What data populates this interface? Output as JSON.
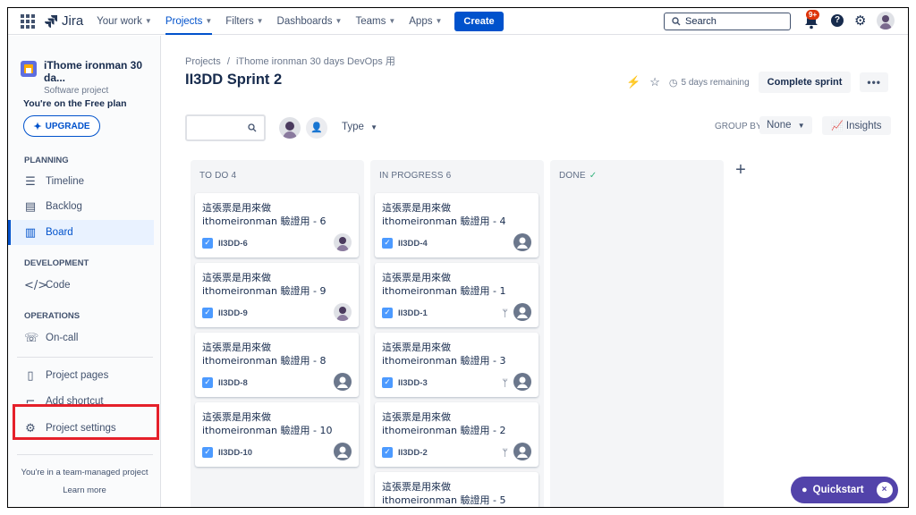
{
  "topnav": {
    "logo_text": "Jira",
    "items": [
      {
        "label": "Your work"
      },
      {
        "label": "Projects"
      },
      {
        "label": "Filters"
      },
      {
        "label": "Dashboards"
      },
      {
        "label": "Teams"
      },
      {
        "label": "Apps"
      }
    ],
    "create_label": "Create",
    "search_placeholder": "Search",
    "notification_badge": "9+"
  },
  "sidebar": {
    "project_name": "iThome ironman 30 da...",
    "project_type": "Software project",
    "plan_text": "You're on the Free plan",
    "upgrade_label": "UPGRADE",
    "planning_title": "PLANNING",
    "timeline_label": "Timeline",
    "backlog_label": "Backlog",
    "board_label": "Board",
    "development_title": "DEVELOPMENT",
    "code_label": "Code",
    "operations_title": "OPERATIONS",
    "oncall_label": "On-call",
    "pages_label": "Project pages",
    "shortcut_label": "Add shortcut",
    "settings_label": "Project settings",
    "team_managed_text": "You're in a team-managed project",
    "learn_more_label": "Learn more"
  },
  "main": {
    "breadcrumb_projects": "Projects",
    "breadcrumb_sep": "/",
    "breadcrumb_project": "iThome ironman 30 days DevOps 用",
    "title": "II3DD Sprint 2",
    "remaining": "5 days remaining",
    "complete_label": "Complete sprint",
    "more_label": "•••",
    "type_label": "Type",
    "group_by_label": "GROUP BY",
    "group_by_value": "None",
    "insights_label": "Insights"
  },
  "columns": [
    {
      "title": "TO DO 4",
      "cards": [
        {
          "title": "這張票是用來做 ithomeironman 驗證用 - 6",
          "key": "II3DD-6",
          "avatar": "photo",
          "branch": false
        },
        {
          "title": "這張票是用來做 ithomeironman 驗證用 - 9",
          "key": "II3DD-9",
          "avatar": "photo",
          "branch": false
        },
        {
          "title": "這張票是用來做 ithomeironman 驗證用 - 8",
          "key": "II3DD-8",
          "avatar": "generic",
          "branch": false
        },
        {
          "title": "這張票是用來做 ithomeironman 驗證用 - 10",
          "key": "II3DD-10",
          "avatar": "generic",
          "branch": false
        }
      ]
    },
    {
      "title": "IN PROGRESS 6",
      "cards": [
        {
          "title": "這張票是用來做 ithomeironman 驗證用 - 4",
          "key": "II3DD-4",
          "avatar": "generic",
          "branch": false
        },
        {
          "title": "這張票是用來做 ithomeironman 驗證用 - 1",
          "key": "II3DD-1",
          "avatar": "generic",
          "branch": true
        },
        {
          "title": "這張票是用來做 ithomeironman 驗證用 - 3",
          "key": "II3DD-3",
          "avatar": "generic",
          "branch": true
        },
        {
          "title": "這張票是用來做 ithomeironman 驗證用 - 2",
          "key": "II3DD-2",
          "avatar": "generic",
          "branch": true
        },
        {
          "title": "這張票是用來做 ithomeironman 驗證用 - 5",
          "key": "",
          "avatar": "none",
          "branch": false
        }
      ]
    },
    {
      "title": "DONE",
      "cards": []
    }
  ],
  "quickstart": {
    "label": "Quickstart",
    "close": "×"
  },
  "colors": {
    "brand": "#0052cc",
    "highlight": "#e5202a",
    "quickstart": "#5243aa"
  }
}
